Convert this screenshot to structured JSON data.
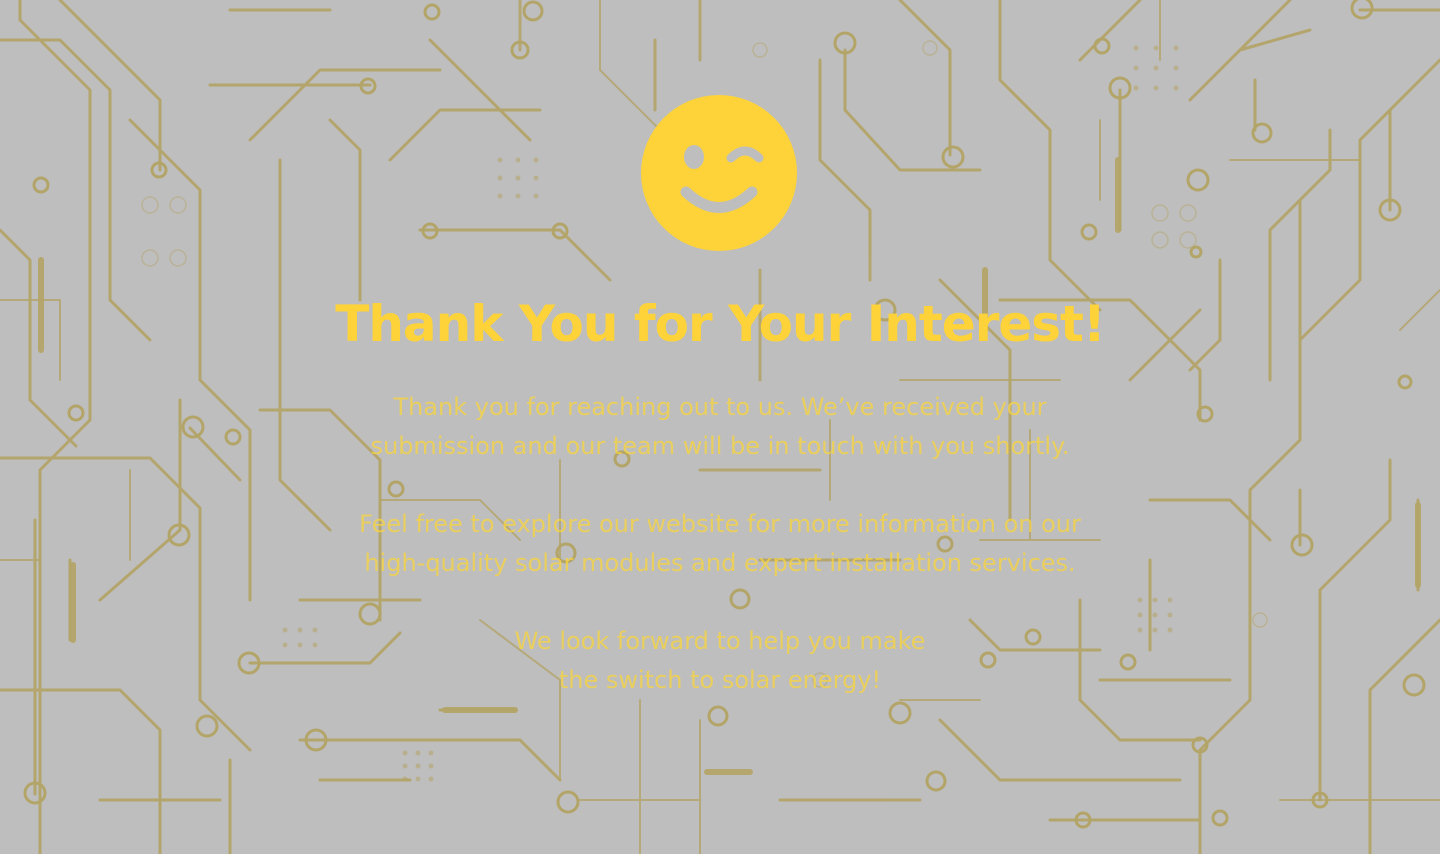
{
  "colors": {
    "background": "#bebebe",
    "circuit": "#b3a468",
    "accent": "#fdd339"
  },
  "icon": "winking-smiley-icon",
  "heading": "Thank You for Your Interest!",
  "paragraphs": [
    {
      "lines": [
        "Thank you for reaching out to us. We’ve received your",
        "submission and our team will be in touch with you shortly."
      ]
    },
    {
      "lines": [
        "Feel free to explore our website for more information on our",
        "high-quality solar modules and expert installation services."
      ]
    },
    {
      "lines": [
        "We look forward to help you make",
        "the switch to solar energy!"
      ]
    }
  ]
}
